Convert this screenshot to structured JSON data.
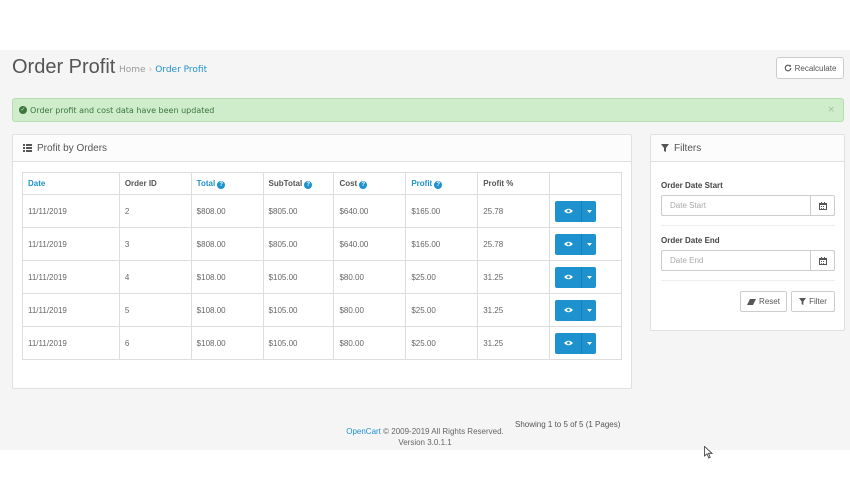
{
  "header": {
    "title": "Order Profit",
    "breadcrumb": [
      "Home",
      "Order Profit"
    ],
    "breadcrumb_sep": "›",
    "recalculate_label": "Recalculate"
  },
  "alert": {
    "text": "Order profit and cost data have been updated",
    "close": "×"
  },
  "main_panel": {
    "title": "Profit by Orders",
    "columns": [
      "Date",
      "Order ID",
      "Total",
      "SubTotal",
      "Cost",
      "Profit",
      "Profit %"
    ],
    "rows": [
      [
        "11/11/2019",
        "2",
        "$808.00",
        "$805.00",
        "$640.00",
        "$165.00",
        "25.78"
      ],
      [
        "11/11/2019",
        "3",
        "$808.00",
        "$805.00",
        "$640.00",
        "$165.00",
        "25.78"
      ],
      [
        "11/11/2019",
        "4",
        "$108.00",
        "$105.00",
        "$80.00",
        "$25.00",
        "31.25"
      ],
      [
        "11/11/2019",
        "5",
        "$108.00",
        "$105.00",
        "$80.00",
        "$25.00",
        "31.25"
      ],
      [
        "11/11/2019",
        "6",
        "$108.00",
        "$105.00",
        "$80.00",
        "$25.00",
        "31.25"
      ]
    ],
    "pagination_info": "Showing 1 to 5 of 5 (1 Pages)"
  },
  "filters": {
    "title": "Filters",
    "date_start_label": "Order Date Start",
    "date_start_placeholder": "Date Start",
    "date_end_label": "Order Date End",
    "date_end_placeholder": "Date End",
    "reset_label": "Reset",
    "filter_label": "Filter"
  },
  "footer": {
    "brand": "OpenCart",
    "copyright": " © 2009-2019 All Rights Reserved.",
    "version": "Version 3.0.1.1"
  },
  "colors": {
    "accent": "#1e91cf",
    "alert_bg": "#cfeccb",
    "alert_text": "#3c763d"
  }
}
